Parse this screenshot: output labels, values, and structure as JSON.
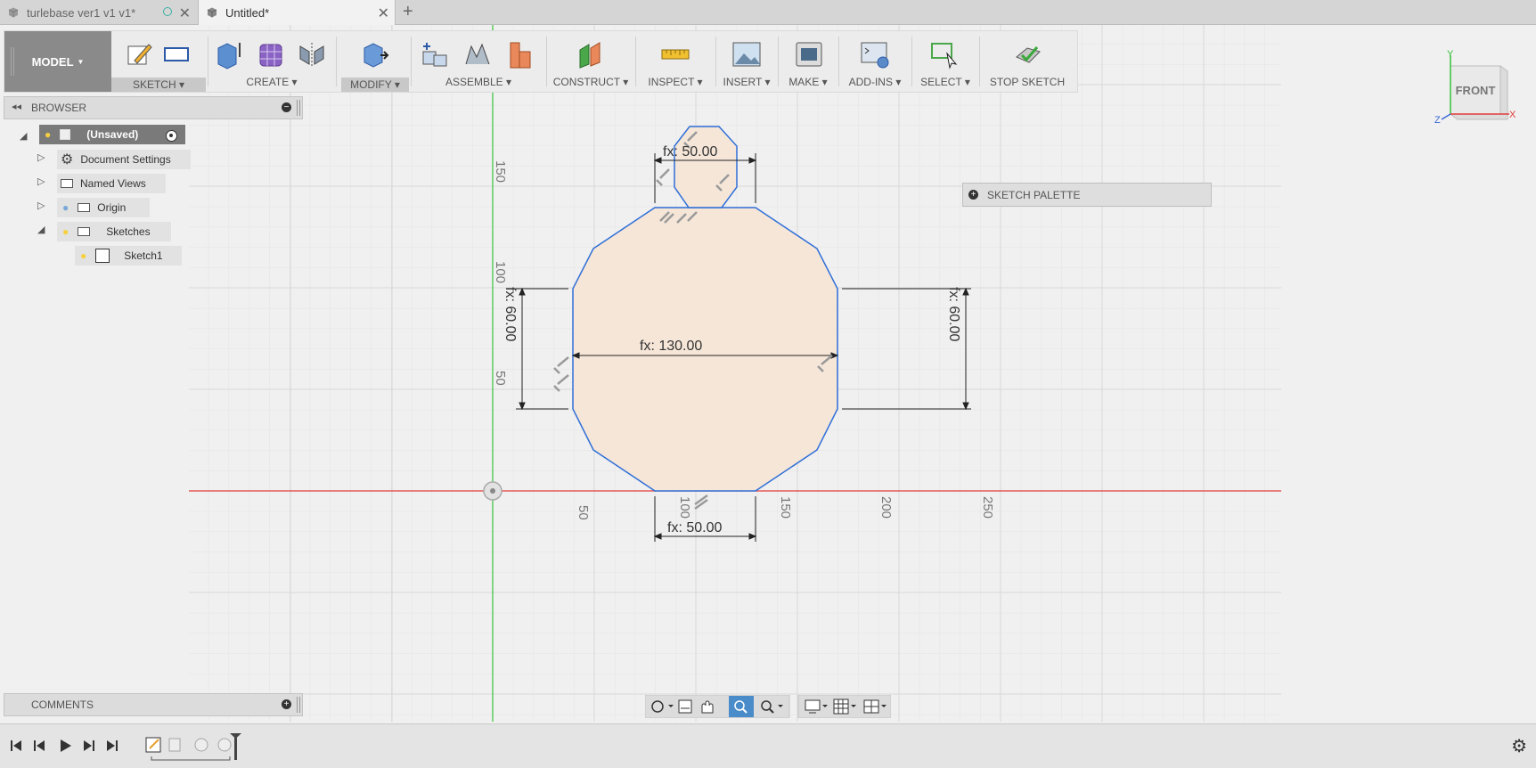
{
  "tabs": [
    {
      "title": "turlebase ver1 v1 v1*"
    },
    {
      "title": "Untitled*"
    }
  ],
  "toolbar": {
    "workspace": "MODEL",
    "groups": [
      "SKETCH",
      "CREATE",
      "MODIFY",
      "ASSEMBLE",
      "CONSTRUCT",
      "INSPECT",
      "INSERT",
      "MAKE",
      "ADD-INS",
      "SELECT",
      "STOP SKETCH"
    ]
  },
  "browser": {
    "title": "BROWSER",
    "items": [
      {
        "label": "(Unsaved)"
      },
      {
        "label": "Document Settings"
      },
      {
        "label": "Named Views"
      },
      {
        "label": "Origin"
      },
      {
        "label": "Sketches"
      },
      {
        "label": "Sketch1"
      }
    ]
  },
  "comments": {
    "title": "COMMENTS"
  },
  "palette": {
    "title": "SKETCH PALETTE"
  },
  "viewcube": {
    "face": "FRONT",
    "axis_y": "Y",
    "axis_x": "X",
    "axis_z": "Z"
  },
  "dimensions": {
    "top_width": "fx: 50.00",
    "main_width": "fx: 130.00",
    "bottom_width": "fx: 50.00",
    "left_height": "fx: 60.00",
    "right_height": "fx: 60.00"
  },
  "grid_labels": {
    "x": [
      "50",
      "100",
      "150",
      "200",
      "250"
    ],
    "y": [
      "150",
      "100",
      "50"
    ]
  },
  "colors": {
    "sketch_line": "#2f6fd8",
    "sketch_fill": "#f5e6d8",
    "x_axis": "#e23a3a",
    "y_axis": "#39c13b",
    "accent_blue": "#4a8bc9"
  }
}
